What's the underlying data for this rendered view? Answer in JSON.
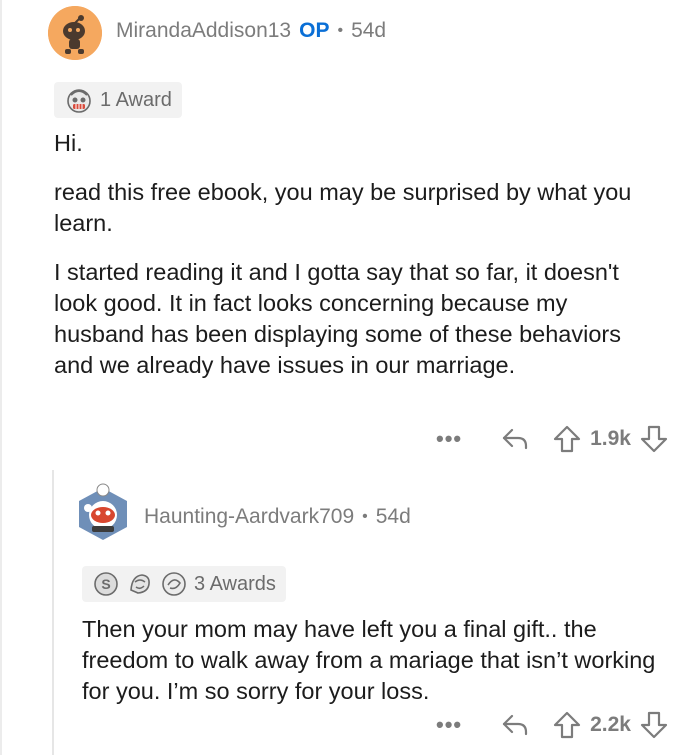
{
  "comment1": {
    "username": "MirandaAddison13",
    "op_badge": "OP",
    "separator": "•",
    "age": "54d",
    "award_label": "1 Award",
    "paragraphs": [
      "Hi.",
      "read this free ebook, you may be surprised by what you learn.",
      "I started reading it and I gotta say that so far, it doesn't look good. It in fact looks concerning because my husband has been displaying some of these behaviors and we already have issues in our marriage."
    ],
    "more_label": "•••",
    "score": "1.9k"
  },
  "comment2": {
    "username": "Haunting-Aardvark709",
    "separator": "•",
    "age": "54d",
    "award_label": "3 Awards",
    "paragraphs": [
      "Then your mom may have left you a final gift.. the freedom to walk away from a mariage that isn’t working for you. I’m so sorry for your loss."
    ],
    "more_label": "•••",
    "score": "2.2k"
  },
  "icons": {
    "avatar1": "snoo-avatar-icon",
    "avatar2": "snoo-avatar-icon",
    "award1": "award-icon",
    "reply": "reply-icon",
    "upvote": "upvote-icon",
    "downvote": "downvote-icon"
  },
  "colors": {
    "op": "#0a6fd6",
    "muted": "#7c7c7c",
    "chip_bg": "#f2f2f2",
    "avatar1_bg": "#f5a85f"
  }
}
